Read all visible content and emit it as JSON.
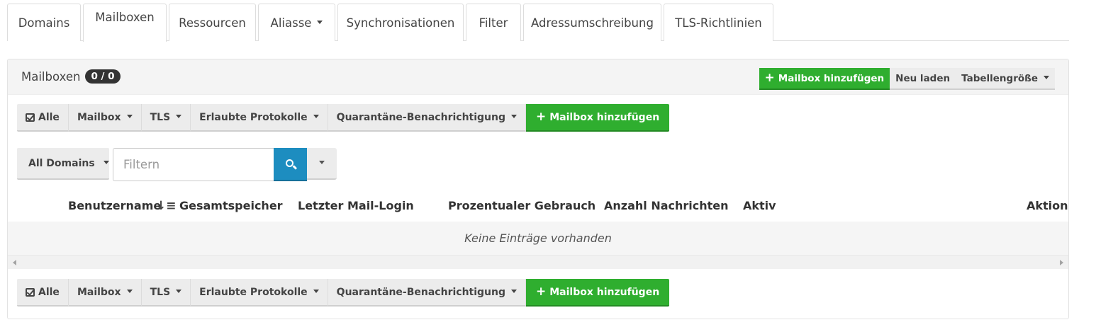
{
  "tabs": [
    {
      "label": "Domains",
      "active": false,
      "dropdown": false
    },
    {
      "label": "Mailboxen",
      "active": true,
      "dropdown": false
    },
    {
      "label": "Ressourcen",
      "active": false,
      "dropdown": false
    },
    {
      "label": "Aliasse",
      "active": false,
      "dropdown": true
    },
    {
      "label": "Synchronisationen",
      "active": false,
      "dropdown": false
    },
    {
      "label": "Filter",
      "active": false,
      "dropdown": false
    },
    {
      "label": "Adressumschreibung",
      "active": false,
      "dropdown": false
    },
    {
      "label": "TLS-Richtlinien",
      "active": false,
      "dropdown": false
    }
  ],
  "panel": {
    "title": "Mailboxen",
    "count_badge": "0 / 0",
    "header_buttons": {
      "add": "Mailbox hinzufügen",
      "reload": "Neu laden",
      "table_size": "Tabellengröße"
    }
  },
  "action_bar": {
    "select_all": "Alle",
    "mailbox": "Mailbox",
    "tls": "TLS",
    "protocols": "Erlaubte Protokolle",
    "quarantine": "Quarantäne-Benachrichtigung",
    "add": "Mailbox hinzufügen"
  },
  "filter": {
    "domain_select": "All Domains",
    "placeholder": "Filtern"
  },
  "table": {
    "columns": {
      "username": "Benutzername",
      "storage": "Gesamtspeicher",
      "last_login": "Letzter Mail-Login",
      "usage": "Prozentualer Gebrauch",
      "messages": "Anzahl Nachrichten",
      "active": "Aktiv",
      "action": "Aktion"
    },
    "empty_message": "Keine Einträge vorhanden"
  },
  "colors": {
    "accent_green": "#2fae2f",
    "search_blue": "#1d8dc0",
    "badge_dark": "#333333"
  }
}
